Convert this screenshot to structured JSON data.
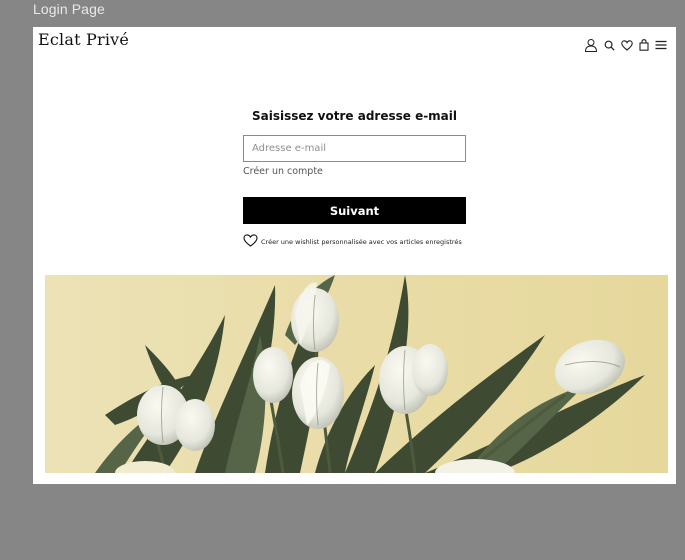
{
  "caption": "Login Page",
  "header": {
    "brand": "Eclat Privé",
    "icons": [
      "user-icon",
      "search-icon",
      "heart-icon",
      "bag-icon",
      "menu-icon"
    ]
  },
  "login": {
    "title": "Saisissez votre adresse e-mail",
    "email_placeholder": "Adresse e-mail",
    "email_value": "",
    "create_account": "Créer un compte",
    "submit": "Suivant",
    "wishlist_note": "Créer une wishlist personnalisée avec vos articles enregistrés"
  },
  "colors": {
    "backdrop": "#868686",
    "page": "#ffffff",
    "button": "#000000",
    "hero_background": "#e8dcaa"
  },
  "hero": {
    "subject": "white-tulips-painting"
  }
}
